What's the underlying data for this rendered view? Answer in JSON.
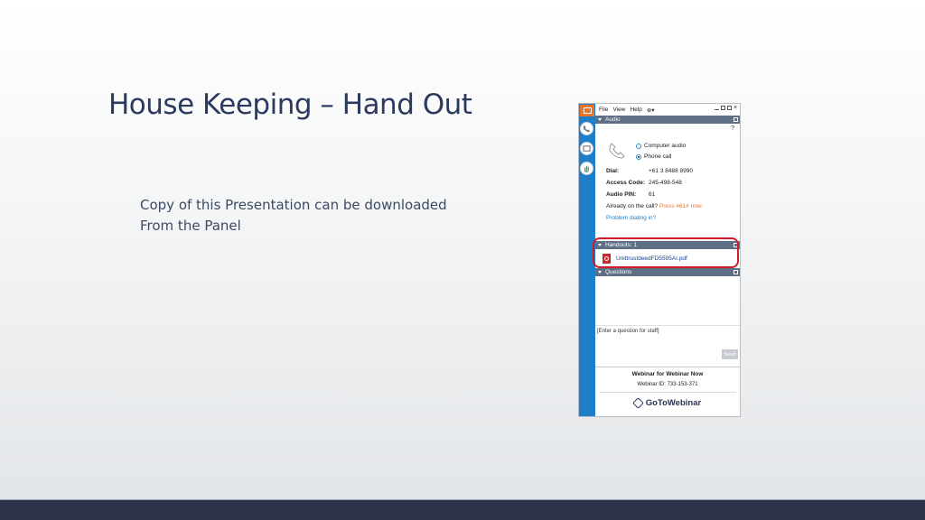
{
  "slide": {
    "title": "House Keeping – Hand Out",
    "body_line1": "Copy of this Presentation can be downloaded",
    "body_line2": "From the Panel"
  },
  "panel": {
    "menu": [
      "File",
      "View",
      "Help"
    ],
    "audio": {
      "header": "Audio",
      "help": "?",
      "options": [
        "Computer audio",
        "Phone call"
      ],
      "selected": "Phone call",
      "dial_label": "Dial:",
      "dial_value": "+61 3 8488 8990",
      "access_label": "Access Code:",
      "access_value": "245-498-548",
      "pin_label": "Audio PIN:",
      "pin_value": "61",
      "already_text": "Already on the call?",
      "press_text": "Press #61# now.",
      "problem_link": "Problem dialing in?"
    },
    "handouts": {
      "header": "Handouts: 1",
      "file": "UnittrustdeedFD5595AI.pdf"
    },
    "questions": {
      "header": "Questions",
      "placeholder": "[Enter a question for staff]",
      "send_label": "Send"
    },
    "webinar": {
      "title": "Webinar for Webinar Now",
      "id": "Webinar ID: 733-153-371",
      "brand": "GoToWebinar"
    }
  },
  "colors": {
    "title": "#2d3a5f",
    "rail_blue": "#1e7fc8",
    "highlight_ring": "#d11a2a",
    "footer": "#2c3248"
  }
}
